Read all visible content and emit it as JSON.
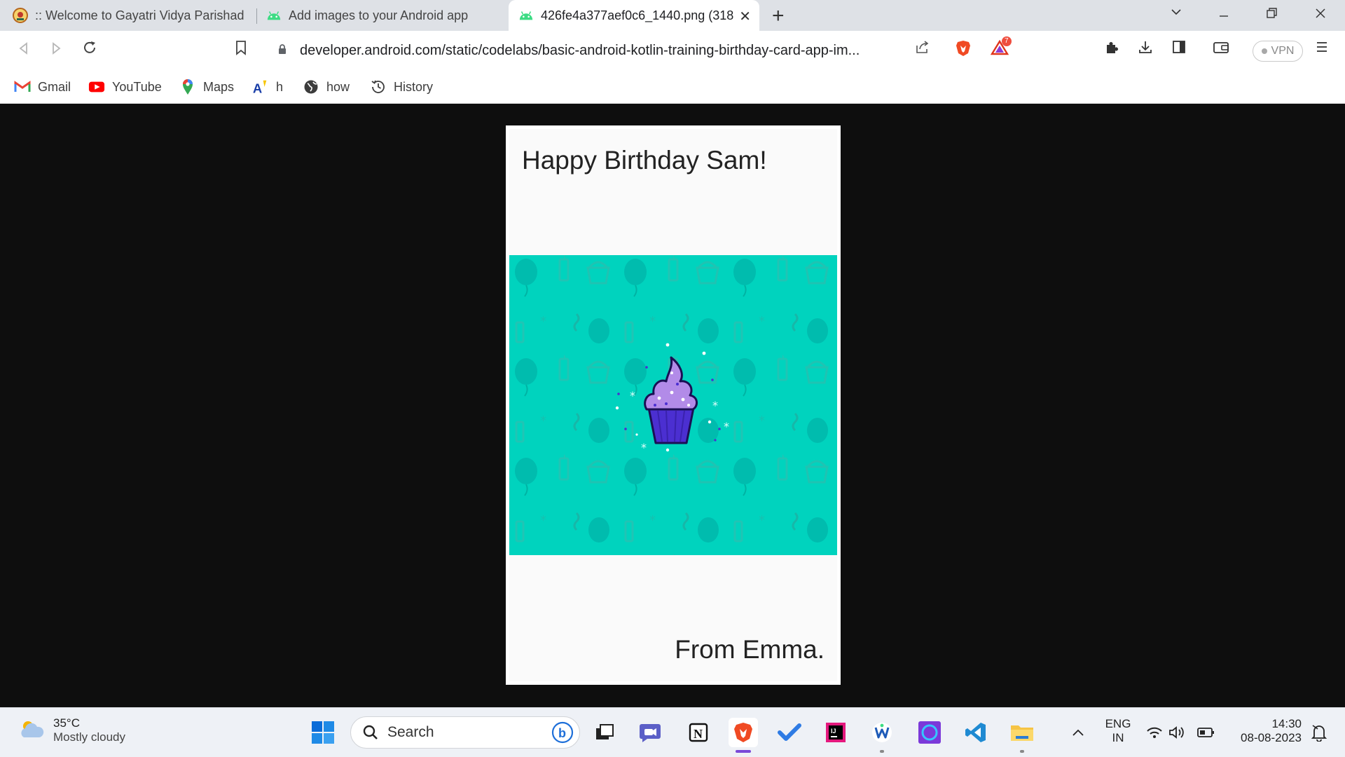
{
  "tabs": [
    {
      "label": ":: Welcome to Gayatri Vidya Parishad C",
      "favicon": "gvp-logo-icon"
    },
    {
      "label": "Add images to your Android app",
      "favicon": "android-icon"
    },
    {
      "label": "426fe4a377aef0c6_1440.png (318",
      "favicon": "android-icon",
      "active": true
    }
  ],
  "toolbar": {
    "url": "developer.android.com/static/codelabs/basic-android-kotlin-training-birthday-card-app-im...",
    "brave_alert_count": "7",
    "vpn_label": "VPN"
  },
  "bookmarks": [
    {
      "label": "Gmail",
      "icon": "gmail-icon"
    },
    {
      "label": "YouTube",
      "icon": "youtube-icon"
    },
    {
      "label": "Maps",
      "icon": "maps-icon"
    },
    {
      "label": "h",
      "icon": "translate-icon"
    },
    {
      "label": "how",
      "icon": "globe-icon"
    },
    {
      "label": "History",
      "icon": "history-icon"
    }
  ],
  "card": {
    "greeting": "Happy Birthday Sam!",
    "signature": "From Emma.",
    "background_color": "#00d3be"
  },
  "taskbar": {
    "weather_temp": "35°C",
    "weather_condition": "Mostly cloudy",
    "search_label": "Search",
    "lang_top": "ENG",
    "lang_bottom": "IN",
    "time": "14:30",
    "date": "08-08-2023"
  },
  "colors": {
    "tabstrip": "#dee1e6",
    "brave_orange": "#f04a23",
    "card_teal": "#00d3be",
    "cupcake_purple": "#b28be8",
    "wrapper_blue": "#4b2fd1"
  }
}
